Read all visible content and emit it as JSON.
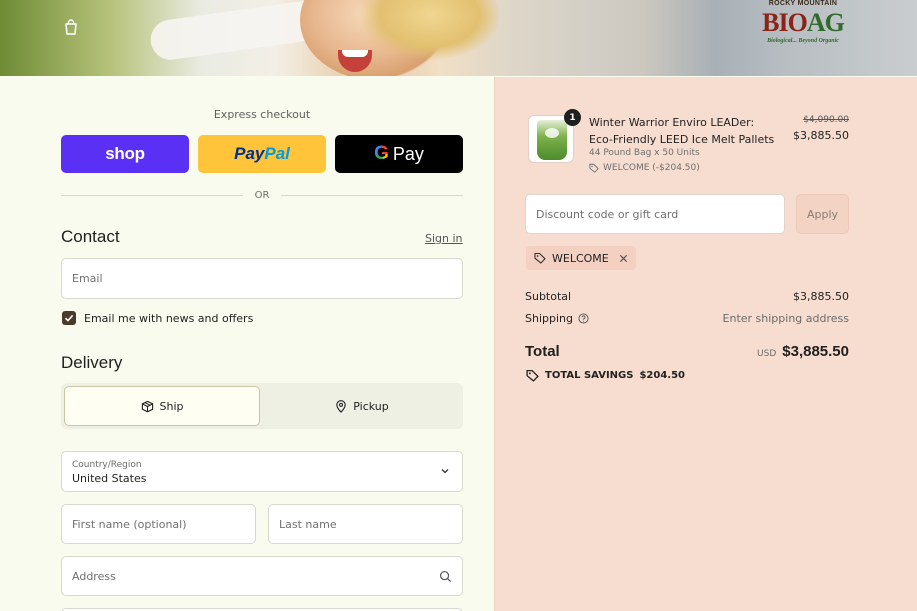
{
  "brand": {
    "logo_line1": "ROCKY MOUNTAIN",
    "logo_line2a": "BIO",
    "logo_line2b": "AG",
    "logo_tagline": "Biological... Beyond Organic"
  },
  "express": {
    "title": "Express checkout",
    "shop_label": "shop",
    "paypal_label_a": "Pay",
    "paypal_label_b": "Pal",
    "gpay_g": "G",
    "gpay_label": "Pay",
    "divider": "OR"
  },
  "contact": {
    "title": "Contact",
    "signin": "Sign in",
    "email_placeholder": "Email",
    "newsletter_label": "Email me with news and offers",
    "newsletter_checked": true
  },
  "delivery": {
    "title": "Delivery",
    "ship_label": "Ship",
    "pickup_label": "Pickup",
    "selected": "Ship",
    "country_label": "Country/Region",
    "country_value": "United States",
    "first_name_placeholder": "First name (optional)",
    "last_name_placeholder": "Last name",
    "address_placeholder": "Address"
  },
  "order": {
    "item": {
      "quantity": "1",
      "name": "Winter Warrior Enviro LEADer: Eco-Friendly LEED Ice Melt Pallets",
      "variant": "44 Pound Bag x 50 Units",
      "discount_note": "WELCOME (-$204.50)",
      "original_price": "$4,090.00",
      "price": "$3,885.50",
      "thumb_label": "LEAD"
    },
    "discount_placeholder": "Discount code or gift card",
    "apply_label": "Apply",
    "applied_code": "WELCOME",
    "subtotal_label": "Subtotal",
    "subtotal_value": "$3,885.50",
    "shipping_label": "Shipping",
    "shipping_value": "Enter shipping address",
    "total_label": "Total",
    "currency": "USD",
    "total_value": "$3,885.50",
    "savings_label": "TOTAL SAVINGS",
    "savings_value": "$204.50"
  },
  "colors": {
    "left_bg": "#f9fbee",
    "right_bg": "#f7ddd0",
    "shop_pay": "#5a31f4",
    "paypal": "#ffc439",
    "gpay": "#000000"
  }
}
